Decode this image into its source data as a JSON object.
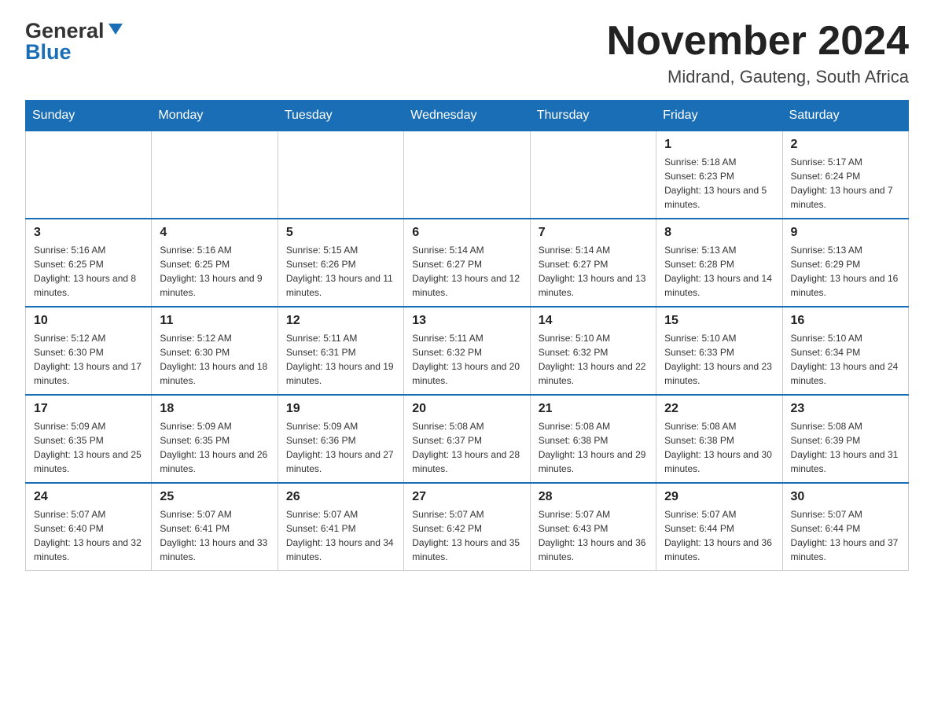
{
  "header": {
    "month_title": "November 2024",
    "location": "Midrand, Gauteng, South Africa",
    "logo_general": "General",
    "logo_blue": "Blue"
  },
  "days_of_week": [
    "Sunday",
    "Monday",
    "Tuesday",
    "Wednesday",
    "Thursday",
    "Friday",
    "Saturday"
  ],
  "weeks": [
    {
      "days": [
        {
          "num": "",
          "info": ""
        },
        {
          "num": "",
          "info": ""
        },
        {
          "num": "",
          "info": ""
        },
        {
          "num": "",
          "info": ""
        },
        {
          "num": "",
          "info": ""
        },
        {
          "num": "1",
          "info": "Sunrise: 5:18 AM\nSunset: 6:23 PM\nDaylight: 13 hours and 5 minutes."
        },
        {
          "num": "2",
          "info": "Sunrise: 5:17 AM\nSunset: 6:24 PM\nDaylight: 13 hours and 7 minutes."
        }
      ]
    },
    {
      "days": [
        {
          "num": "3",
          "info": "Sunrise: 5:16 AM\nSunset: 6:25 PM\nDaylight: 13 hours and 8 minutes."
        },
        {
          "num": "4",
          "info": "Sunrise: 5:16 AM\nSunset: 6:25 PM\nDaylight: 13 hours and 9 minutes."
        },
        {
          "num": "5",
          "info": "Sunrise: 5:15 AM\nSunset: 6:26 PM\nDaylight: 13 hours and 11 minutes."
        },
        {
          "num": "6",
          "info": "Sunrise: 5:14 AM\nSunset: 6:27 PM\nDaylight: 13 hours and 12 minutes."
        },
        {
          "num": "7",
          "info": "Sunrise: 5:14 AM\nSunset: 6:27 PM\nDaylight: 13 hours and 13 minutes."
        },
        {
          "num": "8",
          "info": "Sunrise: 5:13 AM\nSunset: 6:28 PM\nDaylight: 13 hours and 14 minutes."
        },
        {
          "num": "9",
          "info": "Sunrise: 5:13 AM\nSunset: 6:29 PM\nDaylight: 13 hours and 16 minutes."
        }
      ]
    },
    {
      "days": [
        {
          "num": "10",
          "info": "Sunrise: 5:12 AM\nSunset: 6:30 PM\nDaylight: 13 hours and 17 minutes."
        },
        {
          "num": "11",
          "info": "Sunrise: 5:12 AM\nSunset: 6:30 PM\nDaylight: 13 hours and 18 minutes."
        },
        {
          "num": "12",
          "info": "Sunrise: 5:11 AM\nSunset: 6:31 PM\nDaylight: 13 hours and 19 minutes."
        },
        {
          "num": "13",
          "info": "Sunrise: 5:11 AM\nSunset: 6:32 PM\nDaylight: 13 hours and 20 minutes."
        },
        {
          "num": "14",
          "info": "Sunrise: 5:10 AM\nSunset: 6:32 PM\nDaylight: 13 hours and 22 minutes."
        },
        {
          "num": "15",
          "info": "Sunrise: 5:10 AM\nSunset: 6:33 PM\nDaylight: 13 hours and 23 minutes."
        },
        {
          "num": "16",
          "info": "Sunrise: 5:10 AM\nSunset: 6:34 PM\nDaylight: 13 hours and 24 minutes."
        }
      ]
    },
    {
      "days": [
        {
          "num": "17",
          "info": "Sunrise: 5:09 AM\nSunset: 6:35 PM\nDaylight: 13 hours and 25 minutes."
        },
        {
          "num": "18",
          "info": "Sunrise: 5:09 AM\nSunset: 6:35 PM\nDaylight: 13 hours and 26 minutes."
        },
        {
          "num": "19",
          "info": "Sunrise: 5:09 AM\nSunset: 6:36 PM\nDaylight: 13 hours and 27 minutes."
        },
        {
          "num": "20",
          "info": "Sunrise: 5:08 AM\nSunset: 6:37 PM\nDaylight: 13 hours and 28 minutes."
        },
        {
          "num": "21",
          "info": "Sunrise: 5:08 AM\nSunset: 6:38 PM\nDaylight: 13 hours and 29 minutes."
        },
        {
          "num": "22",
          "info": "Sunrise: 5:08 AM\nSunset: 6:38 PM\nDaylight: 13 hours and 30 minutes."
        },
        {
          "num": "23",
          "info": "Sunrise: 5:08 AM\nSunset: 6:39 PM\nDaylight: 13 hours and 31 minutes."
        }
      ]
    },
    {
      "days": [
        {
          "num": "24",
          "info": "Sunrise: 5:07 AM\nSunset: 6:40 PM\nDaylight: 13 hours and 32 minutes."
        },
        {
          "num": "25",
          "info": "Sunrise: 5:07 AM\nSunset: 6:41 PM\nDaylight: 13 hours and 33 minutes."
        },
        {
          "num": "26",
          "info": "Sunrise: 5:07 AM\nSunset: 6:41 PM\nDaylight: 13 hours and 34 minutes."
        },
        {
          "num": "27",
          "info": "Sunrise: 5:07 AM\nSunset: 6:42 PM\nDaylight: 13 hours and 35 minutes."
        },
        {
          "num": "28",
          "info": "Sunrise: 5:07 AM\nSunset: 6:43 PM\nDaylight: 13 hours and 36 minutes."
        },
        {
          "num": "29",
          "info": "Sunrise: 5:07 AM\nSunset: 6:44 PM\nDaylight: 13 hours and 36 minutes."
        },
        {
          "num": "30",
          "info": "Sunrise: 5:07 AM\nSunset: 6:44 PM\nDaylight: 13 hours and 37 minutes."
        }
      ]
    }
  ],
  "colors": {
    "header_bg": "#1a6eb5",
    "header_text": "#ffffff",
    "border": "#1a6eb5"
  }
}
